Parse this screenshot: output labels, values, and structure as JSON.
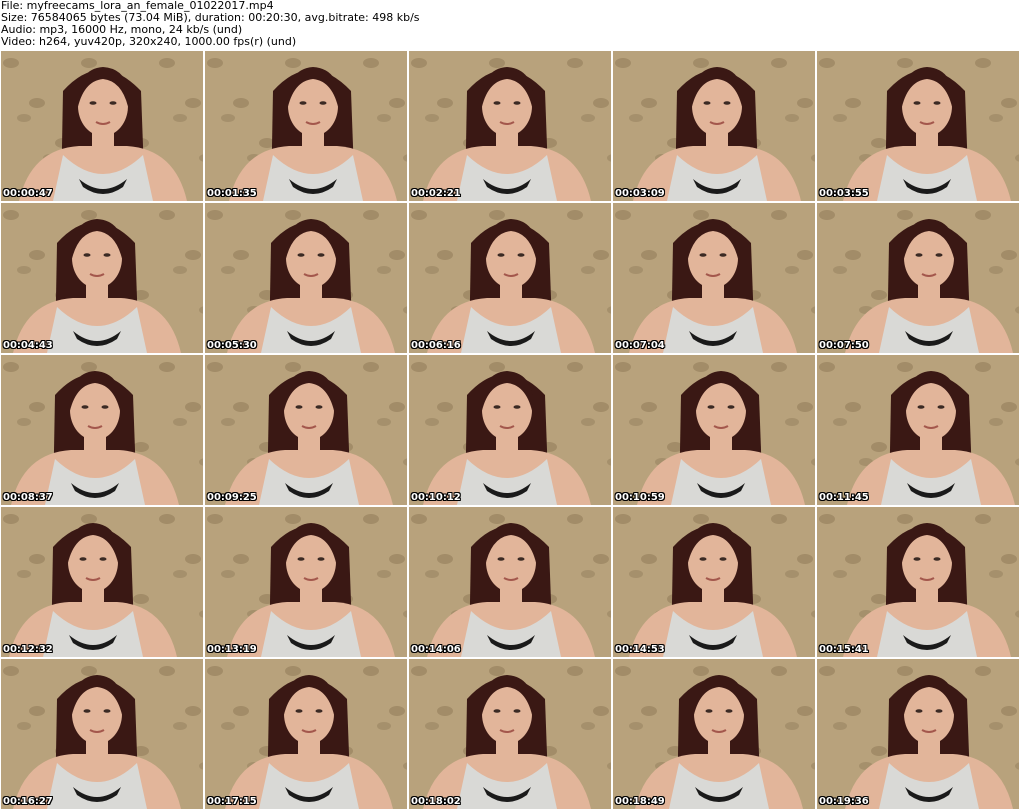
{
  "header": {
    "file_line": "File: myfreecams_lora_an_female_01022017.mp4",
    "size_line": "Size: 76584065 bytes (73.04 MiB), duration: 00:20:30, avg.bitrate: 498 kb/s",
    "audio_line": "Audio: mp3, 16000 Hz, mono, 24 kb/s (und)",
    "video_line": "Video: h264, yuv420p, 320x240, 1000.00 fps(r) (und)"
  },
  "thumbnails": [
    {
      "timestamp": "00:00:47"
    },
    {
      "timestamp": "00:01:35"
    },
    {
      "timestamp": "00:02:21"
    },
    {
      "timestamp": "00:03:09"
    },
    {
      "timestamp": "00:03:55"
    },
    {
      "timestamp": "00:04:43"
    },
    {
      "timestamp": "00:05:30"
    },
    {
      "timestamp": "00:06:16"
    },
    {
      "timestamp": "00:07:04"
    },
    {
      "timestamp": "00:07:50"
    },
    {
      "timestamp": "00:08:37"
    },
    {
      "timestamp": "00:09:25"
    },
    {
      "timestamp": "00:10:12"
    },
    {
      "timestamp": "00:10:59"
    },
    {
      "timestamp": "00:11:45"
    },
    {
      "timestamp": "00:12:32"
    },
    {
      "timestamp": "00:13:19"
    },
    {
      "timestamp": "00:14:06"
    },
    {
      "timestamp": "00:14:53"
    },
    {
      "timestamp": "00:15:41"
    },
    {
      "timestamp": "00:16:27"
    },
    {
      "timestamp": "00:17:15"
    },
    {
      "timestamp": "00:18:02"
    },
    {
      "timestamp": "00:18:49"
    },
    {
      "timestamp": "00:19:36"
    }
  ],
  "colors": {
    "wallpaper": "#b8a27c",
    "wallpaper_pattern": "#8f7a58",
    "hair": "#3a1814",
    "skin": "#e2b59a",
    "top": "#d9d9d6",
    "bra": "#1a1a1a"
  }
}
